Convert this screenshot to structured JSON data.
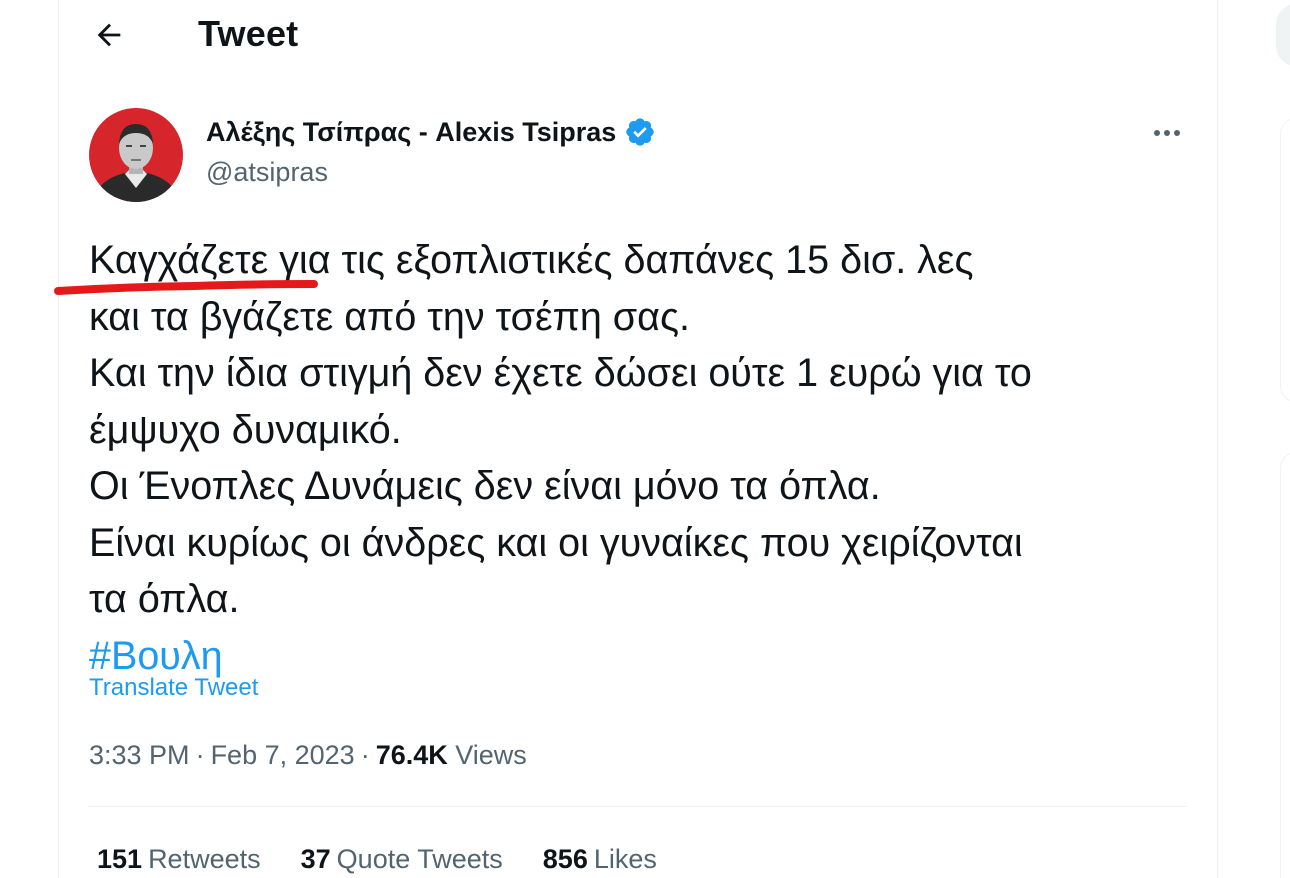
{
  "header": {
    "title": "Tweet",
    "back_icon": "arrow-left-icon"
  },
  "author": {
    "display_name": "Αλέξης Τσίπρας - Alexis Tsipras",
    "handle": "@atsipras",
    "verified_icon": "verified-badge-icon",
    "more_icon": "ellipsis-icon"
  },
  "tweet": {
    "first_word": "Καγχάζετε",
    "lines": [
      " για τις εξοπλιστικές δαπάνες 15 δισ. λες",
      "και τα βγάζετε από την τσέπη σας.",
      "Και την ίδια στιγμή δεν έχετε δώσει ούτε 1 ευρώ για το",
      "έμψυχο δυναμικό.",
      "Οι Ένοπλες Δυνάμεις δεν είναι μόνο τα όπλα.",
      "Είναι κυρίως οι άνδρες και οι γυναίκες που χειρίζονται",
      "τα όπλα."
    ],
    "hashtag": "#Βουλη",
    "translate_label": "Translate Tweet"
  },
  "meta": {
    "time": "3:33 PM",
    "separator": "·",
    "date": "Feb 7, 2023",
    "views_count": "76.4K",
    "views_label": "Views"
  },
  "stats": {
    "retweets_count": "151",
    "retweets_label": "Retweets",
    "quotes_count": "37",
    "quotes_label": "Quote Tweets",
    "likes_count": "856",
    "likes_label": "Likes"
  },
  "colors": {
    "accent": "#1d9bf0",
    "text_primary": "#0f1419",
    "text_secondary": "#536471",
    "annotation_red": "#e3191c",
    "avatar_bg": "#d7262b"
  }
}
